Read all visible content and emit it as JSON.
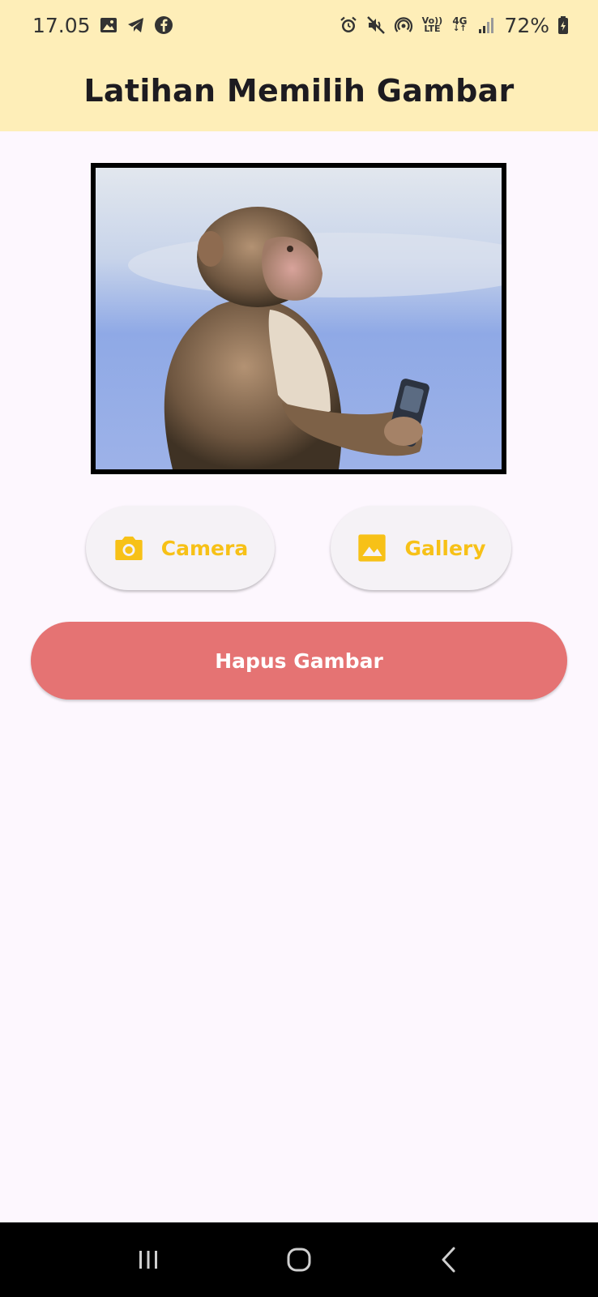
{
  "status_bar": {
    "time": "17.05",
    "left_icons": [
      "image-icon",
      "telegram-icon",
      "facebook-icon"
    ],
    "right_icons": [
      "alarm-icon",
      "mute-icon",
      "hotspot-icon",
      "volte-icon",
      "4g-icon",
      "signal-icon",
      "battery-icon"
    ],
    "volte_top": "Vo))",
    "volte_bottom": "LTE",
    "network": "4G",
    "battery": "72%"
  },
  "app_bar": {
    "title": "Latihan Memilih Gambar"
  },
  "image": {
    "description_icon": "selected-image"
  },
  "buttons": {
    "camera_label": "Camera",
    "gallery_label": "Gallery",
    "delete_label": "Hapus Gambar"
  },
  "colors": {
    "app_bar_bg": "#feeeb8",
    "page_bg": "#fdf7fe",
    "accent": "#f7c117",
    "delete_bg": "#e57373",
    "nav_bg": "#000000"
  },
  "nav_bar": {
    "items": [
      "recent-apps-icon",
      "home-icon",
      "back-icon"
    ]
  }
}
